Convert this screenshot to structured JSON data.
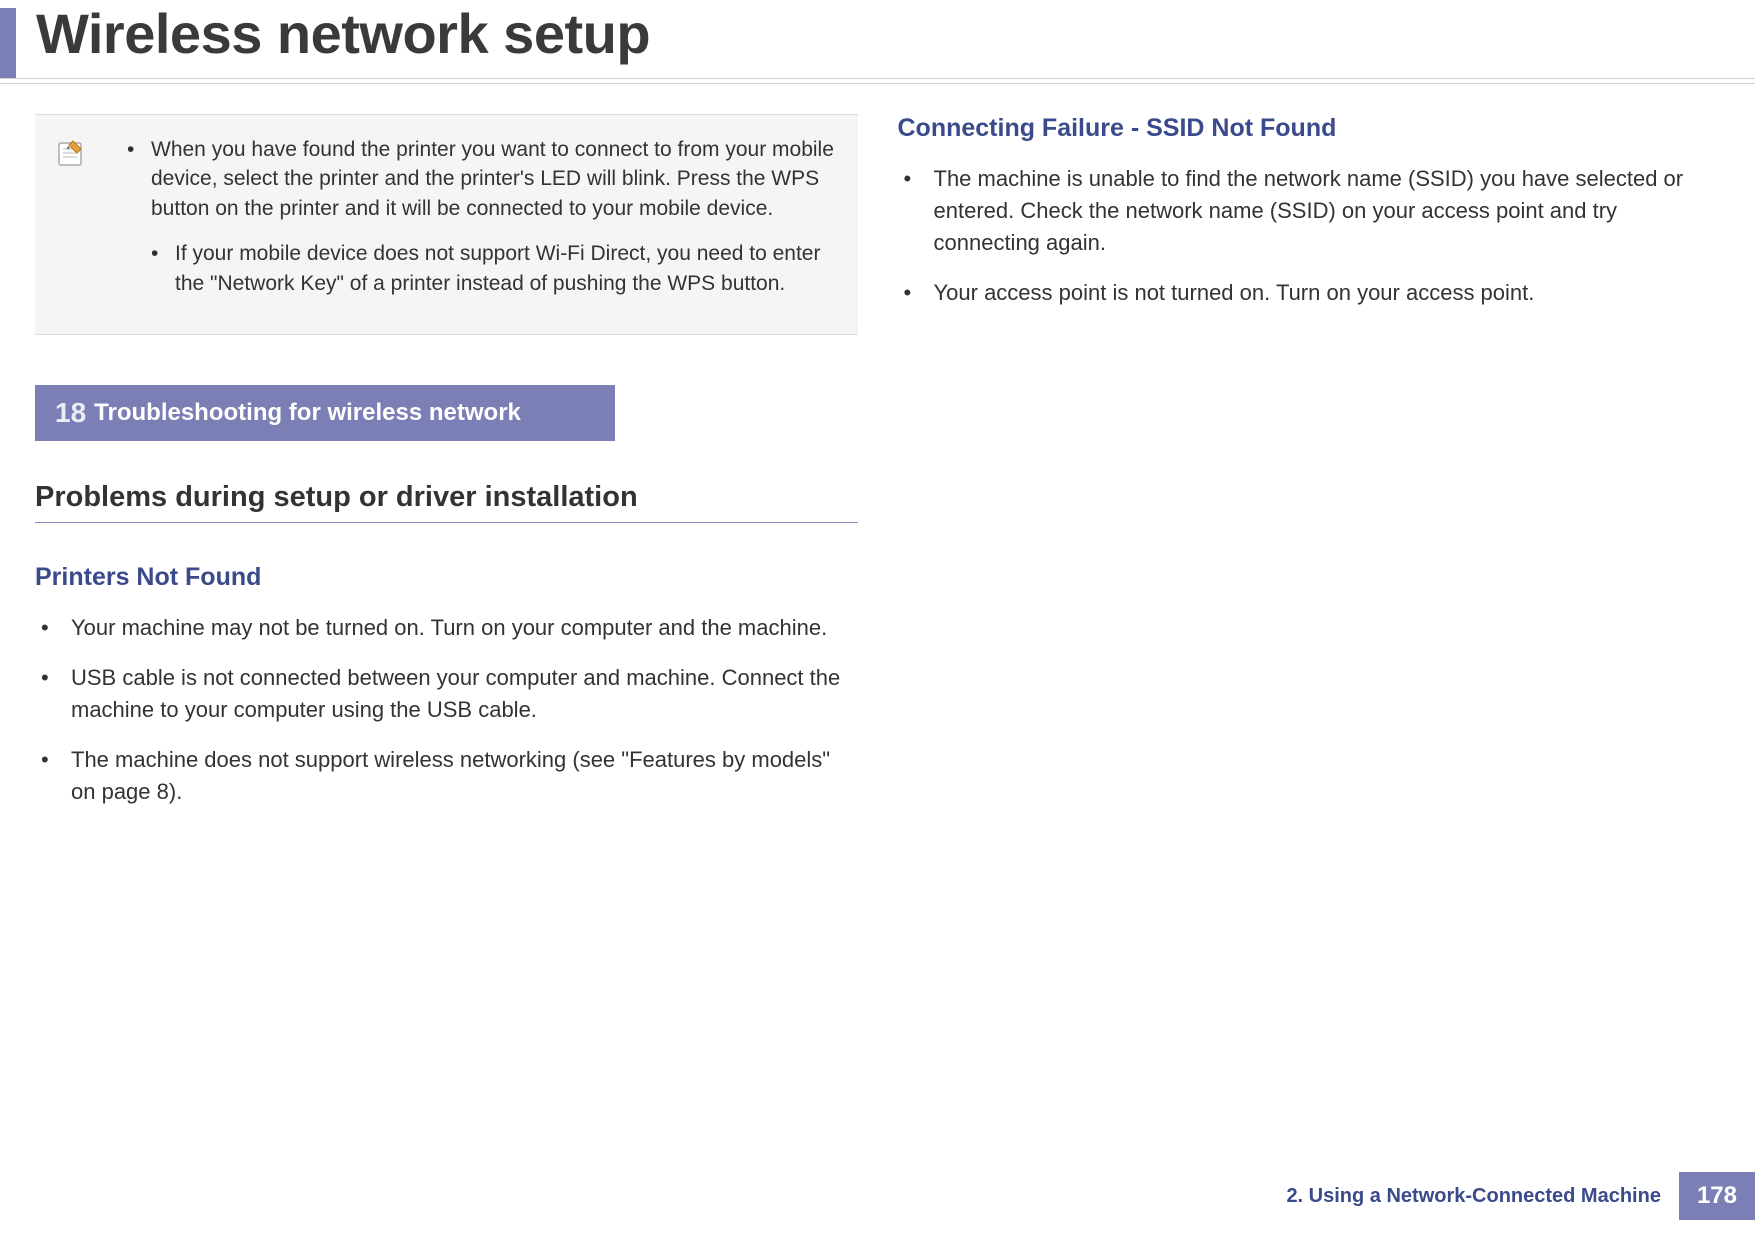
{
  "header": {
    "title": "Wireless network setup"
  },
  "note": {
    "items": [
      {
        "text": "When you have found the printer you want to connect to from your mobile device, select the printer and the printer's LED will blink. Press the WPS button on the printer and it will be connected to your mobile device.",
        "sub": [
          " If your mobile device does not support Wi-Fi Direct, you need to enter the \"Network Key\" of a printer instead of pushing the WPS button."
        ]
      }
    ]
  },
  "section": {
    "number": "18",
    "title": "Troubleshooting for wireless network"
  },
  "subsection": {
    "title": "Problems during setup or driver installation"
  },
  "topics": {
    "printers_not_found": {
      "heading": "Printers Not Found",
      "items": [
        "Your machine may not be turned on. Turn on your computer and the machine.",
        "USB cable is not connected between your computer and machine. Connect the machine to your computer using the USB cable.",
        "The machine does not support wireless networking (see \"Features by models\" on page 8)."
      ]
    },
    "ssid_not_found": {
      "heading": "Connecting Failure - SSID Not Found",
      "items": [
        "The machine is unable to find the network name (SSID) you have selected or entered. Check the network name (SSID) on your access point and try connecting again.",
        "Your access point is not turned on. Turn on your access point."
      ]
    }
  },
  "footer": {
    "chapter": "2.  Using a Network-Connected Machine",
    "page": "178"
  }
}
